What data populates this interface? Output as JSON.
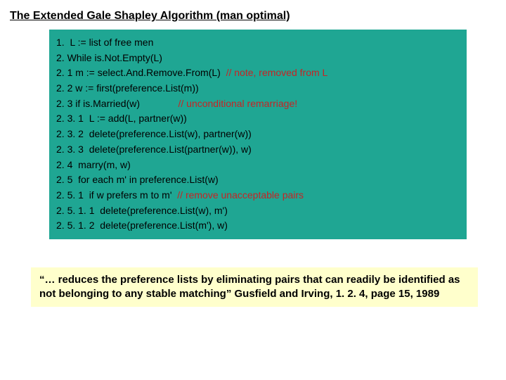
{
  "title": "The Extended Gale Shapley Algorithm (man optimal)",
  "code": {
    "l1": "1.  L := list of free men",
    "l2": "2. While is.Not.Empty(L)",
    "l3a": "2. 1 m := select.And.Remove.From(L)  ",
    "l3c": "// note, removed from L",
    "l4": "2. 2 w := first(preference.List(m))",
    "l5a": "2. 3 if is.Married(w)              ",
    "l5c": "// unconditional remarriage!",
    "l6": "2. 3. 1  L := add(L, partner(w))",
    "l7": "2. 3. 2  delete(preference.List(w), partner(w))",
    "l8": "2. 3. 3  delete(preference.List(partner(w)), w)",
    "l9": "2. 4  marry(m, w)",
    "l10": "2. 5  for each m' in preference.List(w)",
    "l11a": "2. 5. 1  if w prefers m to m'  ",
    "l11c": "// remove unacceptable pairs",
    "l12": "2. 5. 1. 1  delete(preference.List(w), m')",
    "l13": "2. 5. 1. 2  delete(preference.List(m'), w)"
  },
  "quote": "“… reduces the preference lists by eliminating pairs that can readily be identified as not belonging to any stable matching” Gusfield and Irving, 1. 2. 4, page 15, 1989"
}
